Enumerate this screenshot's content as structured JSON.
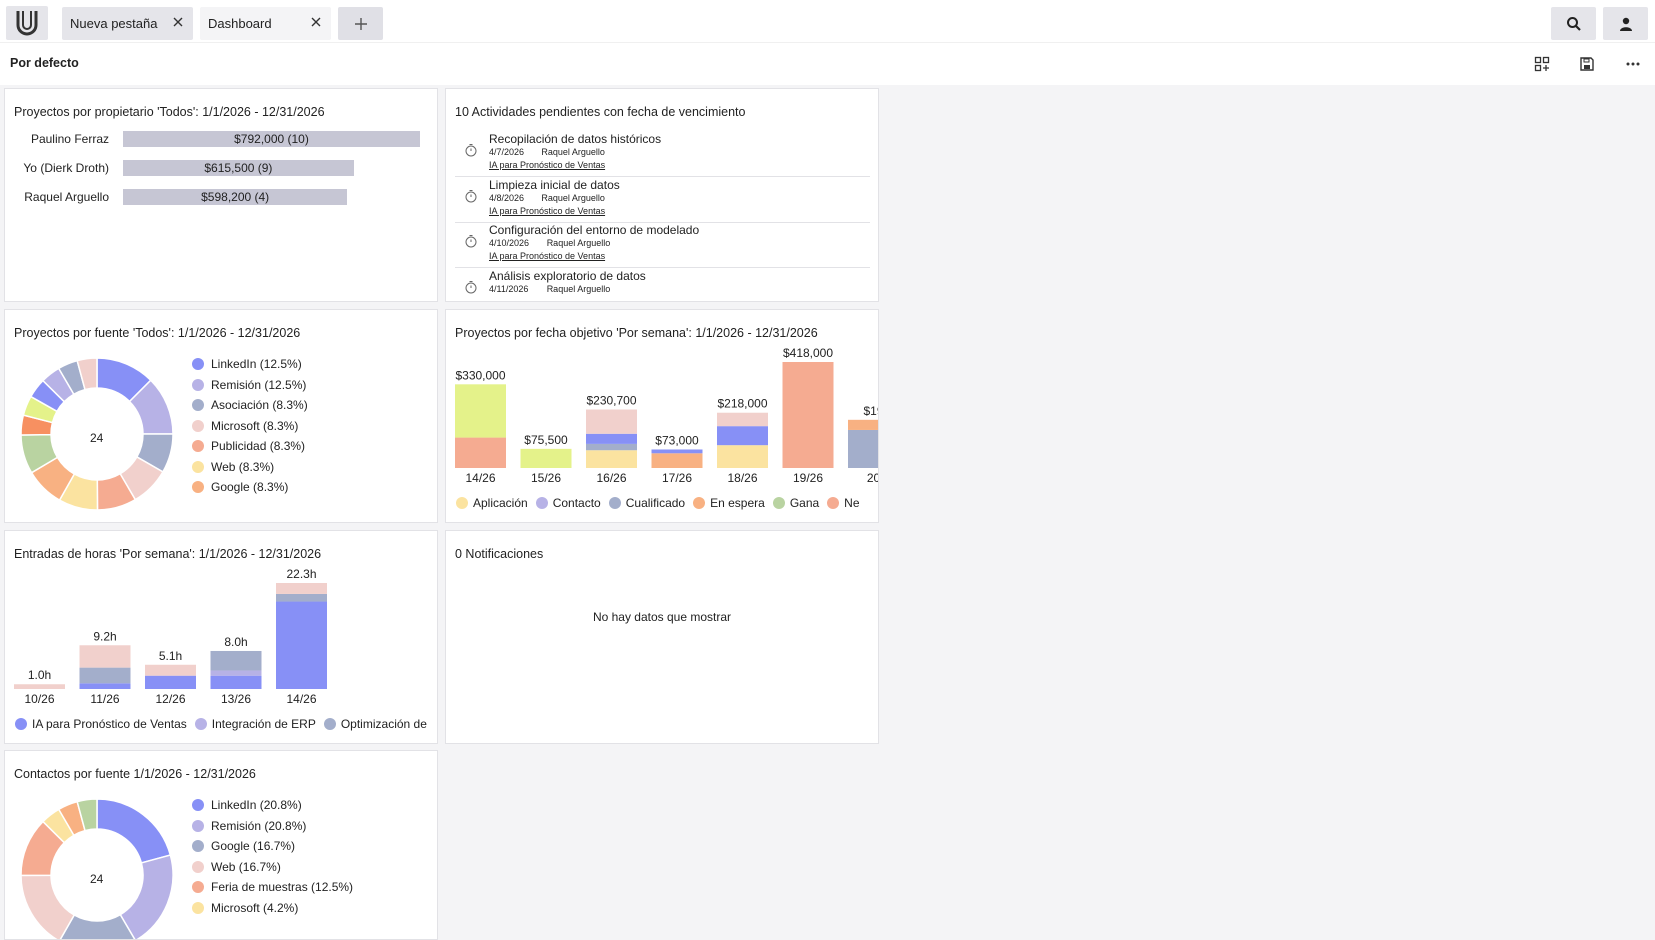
{
  "tabs": [
    {
      "label": "Nueva pestaña"
    },
    {
      "label": "Dashboard"
    }
  ],
  "subbar": {
    "title": "Por defecto"
  },
  "owner_card": {
    "title": "Proyectos por propietario 'Todos': 1/1/2026 - 12/31/2026",
    "chart_data": {
      "type": "bar",
      "orientation": "horizontal",
      "categories": [
        "Paulino Ferraz",
        "Yo (Dierk Droth)",
        "Raquel Arguello"
      ],
      "values": [
        792000,
        615500,
        598200
      ],
      "labels": [
        "$792,000 (10)",
        "$615,500 (9)",
        "$598,200 (4)"
      ],
      "xlim": [
        0,
        792000
      ]
    }
  },
  "activities": {
    "title": "10 Actividades pendientes con fecha de vencimiento",
    "items": [
      {
        "title": "Recopilación de datos históricos",
        "date": "4/7/2026",
        "owner": "Raquel Arguello",
        "project": "IA para Pronóstico de Ventas"
      },
      {
        "title": "Limpieza inicial de datos",
        "date": "4/8/2026",
        "owner": "Raquel Arguello",
        "project": "IA para Pronóstico de Ventas"
      },
      {
        "title": "Configuración del entorno de modelado",
        "date": "4/10/2026",
        "owner": "Raquel Arguello",
        "project": "IA para Pronóstico de Ventas"
      },
      {
        "title": "Análisis exploratorio de datos",
        "date": "4/11/2026",
        "owner": "Raquel Arguello",
        "project": ""
      }
    ]
  },
  "source_card": {
    "title": "Proyectos por fuente 'Todos': 1/1/2026 - 12/31/2026",
    "center": "24",
    "chart_data": {
      "type": "pie",
      "total": 24,
      "legend": [
        {
          "label": "LinkedIn (12.5%)",
          "color": "#8790f6",
          "value": 12.5
        },
        {
          "label": "Remisión (12.5%)",
          "color": "#b7b2e6",
          "value": 12.5
        },
        {
          "label": "Asociación (8.3%)",
          "color": "#a3aecb",
          "value": 8.3
        },
        {
          "label": "Microsoft (8.3%)",
          "color": "#f1d0cc",
          "value": 8.3
        },
        {
          "label": "Publicidad (8.3%)",
          "color": "#f5ab91",
          "value": 8.3
        },
        {
          "label": "Web (8.3%)",
          "color": "#fbe3a0",
          "value": 8.3
        },
        {
          "label": "Google (8.3%)",
          "color": "#f8b182",
          "value": 8.3
        }
      ],
      "other_values": [
        8.3,
        4.2,
        4.2,
        4.2,
        4.2,
        4.2,
        4.2
      ],
      "other_colors": [
        "#b9d3a1",
        "#f79061",
        "#e4f28a",
        "#8790f6",
        "#b7b2e6",
        "#a3aecb",
        "#f1d0cc"
      ]
    }
  },
  "target_card": {
    "title": "Proyectos por fecha objetivo 'Por semana': 1/1/2026 - 12/31/2026",
    "chart_data": {
      "type": "bar",
      "stacked": true,
      "categories": [
        "14/26",
        "15/26",
        "16/26",
        "17/26",
        "18/26",
        "19/26",
        "20"
      ],
      "totals": [
        "$330,000",
        "$75,500",
        "$230,700",
        "$73,000",
        "$218,000",
        "$418,000",
        "$19"
      ],
      "ylim": [
        0,
        418000
      ],
      "series": [
        {
          "name": "Aplicación",
          "color": "#fbe3a0",
          "values": [
            0,
            0,
            70000,
            0,
            90000,
            0,
            0
          ]
        },
        {
          "name": "Contacto",
          "color": "#b7b2e6",
          "values": [
            0,
            0,
            0,
            0,
            0,
            0,
            0
          ]
        },
        {
          "name": "Cualificado",
          "color": "#a3aecb",
          "values": [
            0,
            0,
            25000,
            0,
            0,
            0,
            150000
          ]
        },
        {
          "name": "En espera",
          "color": "#f8b182",
          "values": [
            0,
            0,
            0,
            58000,
            0,
            0,
            40000
          ]
        },
        {
          "name": "Gana",
          "color": "#b9d3a1",
          "values": [
            0,
            0,
            0,
            0,
            0,
            0,
            0
          ]
        },
        {
          "name": "Ne",
          "color": "#f5ab91",
          "values": [
            120000,
            0,
            0,
            0,
            0,
            418000,
            0
          ]
        },
        {
          "name": "",
          "color": "#e4f28a",
          "values": [
            210000,
            75500,
            0,
            0,
            0,
            0,
            0
          ]
        },
        {
          "name": "",
          "color": "#8790f6",
          "values": [
            0,
            0,
            40000,
            15000,
            75000,
            0,
            0
          ]
        },
        {
          "name": "",
          "color": "#f1d0cc",
          "values": [
            0,
            0,
            95700,
            0,
            53000,
            0,
            0
          ]
        }
      ]
    }
  },
  "hours_card": {
    "title": "Entradas de horas 'Por semana': 1/1/2026 - 12/31/2026",
    "chart_data": {
      "type": "bar",
      "stacked": true,
      "categories": [
        "10/26",
        "11/26",
        "12/26",
        "13/26",
        "14/26"
      ],
      "totals": [
        "1.0h",
        "9.2h",
        "5.1h",
        "8.0h",
        "22.3h"
      ],
      "ylim": [
        0,
        22.3
      ],
      "series": [
        {
          "name": "IA para Pronóstico de Ventas",
          "color": "#8790f6",
          "values": [
            0,
            1.2,
            2.8,
            2.8,
            18.4
          ]
        },
        {
          "name": "Integración de ERP",
          "color": "#b7b2e6",
          "values": [
            0,
            0,
            0,
            1.1,
            0
          ]
        },
        {
          "name": "Optimización de",
          "color": "#a3aecb",
          "values": [
            0,
            3.3,
            0,
            4.1,
            1.6
          ]
        },
        {
          "name": "",
          "color": "#f1d0cc",
          "values": [
            1.0,
            4.7,
            2.3,
            0,
            2.3
          ]
        }
      ]
    }
  },
  "notifications": {
    "title": "0 Notificaciones",
    "empty": "No hay datos que mostrar"
  },
  "contacts_card": {
    "title": "Contactos por fuente 1/1/2026 - 12/31/2026",
    "center": "24",
    "chart_data": {
      "type": "pie",
      "total": 24,
      "legend": [
        {
          "label": "LinkedIn (20.8%)",
          "color": "#8790f6",
          "value": 20.8
        },
        {
          "label": "Remisión (20.8%)",
          "color": "#b7b2e6",
          "value": 20.8
        },
        {
          "label": "Google (16.7%)",
          "color": "#a3aecb",
          "value": 16.7
        },
        {
          "label": "Web (16.7%)",
          "color": "#f1d0cc",
          "value": 16.7
        },
        {
          "label": "Feria de muestras (12.5%)",
          "color": "#f5ab91",
          "value": 12.5
        },
        {
          "label": "Microsoft (4.2%)",
          "color": "#fbe3a0",
          "value": 4.2
        }
      ],
      "other_values": [
        4.2,
        4.2
      ],
      "other_colors": [
        "#f8b182",
        "#b9d3a1"
      ]
    }
  }
}
